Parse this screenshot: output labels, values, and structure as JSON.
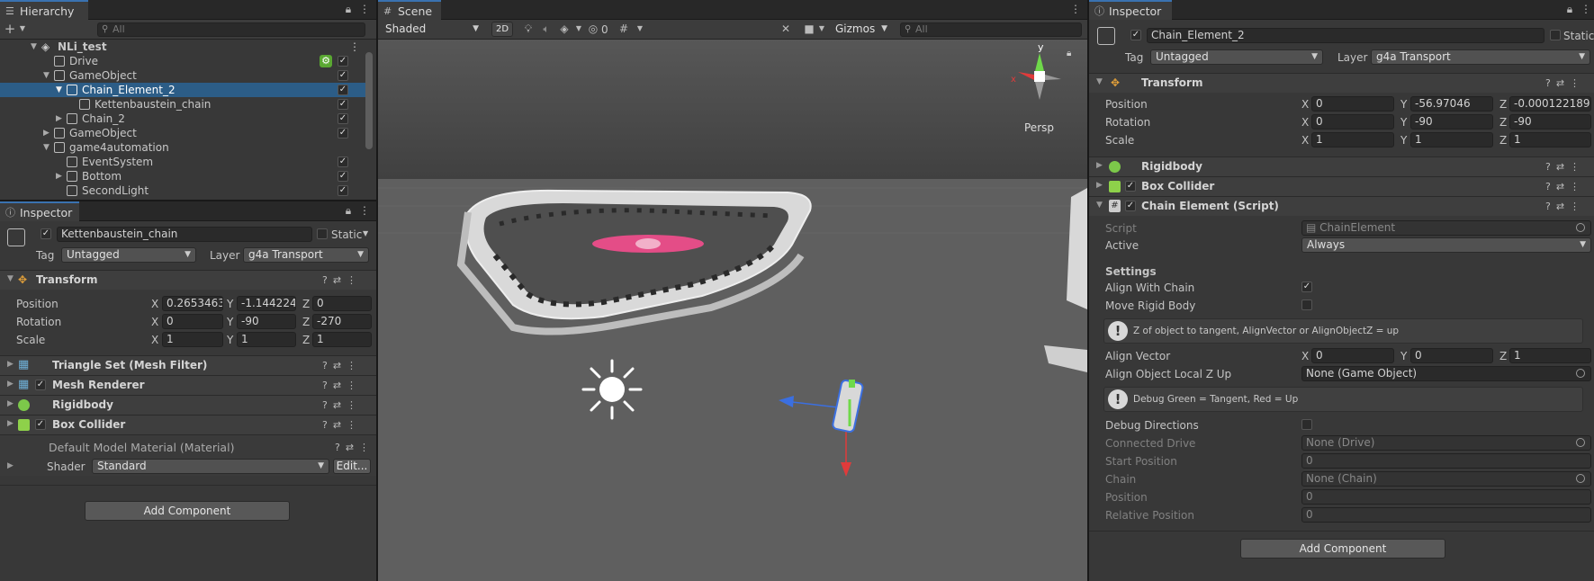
{
  "hierarchy": {
    "tab": "Hierarchy",
    "search_placeholder": "All",
    "rows": [
      {
        "label": "NLi_test"
      },
      {
        "label": "Drive"
      },
      {
        "label": "GameObject"
      },
      {
        "label": "Chain_Element_2"
      },
      {
        "label": "Kettenbaustein_chain"
      },
      {
        "label": "Chain_2"
      },
      {
        "label": "GameObject"
      },
      {
        "label": "game4automation"
      },
      {
        "label": "EventSystem"
      },
      {
        "label": "Bottom"
      },
      {
        "label": "SecondLight"
      }
    ]
  },
  "left_inspector": {
    "tab": "Inspector",
    "object_name": "Kettenbaustein_chain",
    "static_label": "Static",
    "tag_label": "Tag",
    "tag_value": "Untagged",
    "layer_label": "Layer",
    "layer_value": "g4a Transport",
    "transform": {
      "title": "Transform",
      "position_label": "Position",
      "rotation_label": "Rotation",
      "scale_label": "Scale",
      "position": {
        "x": "0.2653463",
        "y": "-1.144224",
        "z": "0"
      },
      "rotation": {
        "x": "0",
        "y": "-90",
        "z": "-270"
      },
      "scale": {
        "x": "1",
        "y": "1",
        "z": "1"
      }
    },
    "components": [
      "Triangle Set (Mesh Filter)",
      "Mesh Renderer",
      "Rigidbody",
      "Box Collider"
    ],
    "material": "Default Model Material (Material)",
    "shader_label": "Shader",
    "shader_value": "Standard",
    "edit_label": "Edit...",
    "add_component": "Add Component"
  },
  "scene": {
    "tab": "Scene",
    "shading": "Shaded",
    "mode_2d": "2D",
    "hidden_count": "0",
    "gizmos": "Gizmos",
    "search_placeholder": "All",
    "persp": "Persp",
    "gizmo_y": "y",
    "gizmo_x": "x"
  },
  "right_inspector": {
    "tab": "Inspector",
    "object_name": "Chain_Element_2",
    "static_label": "Static",
    "tag_label": "Tag",
    "tag_value": "Untagged",
    "layer_label": "Layer",
    "layer_value": "g4a Transport",
    "transform": {
      "title": "Transform",
      "position_label": "Position",
      "rotation_label": "Rotation",
      "scale_label": "Scale",
      "position": {
        "x": "0",
        "y": "-56.97046",
        "z": "-0.0001221895"
      },
      "rotation": {
        "x": "0",
        "y": "-90",
        "z": "-90"
      },
      "scale": {
        "x": "1",
        "y": "1",
        "z": "1"
      }
    },
    "components": [
      "Rigidbody",
      "Box Collider",
      "Chain Element (Script)"
    ],
    "script_label": "Script",
    "script_value": "ChainElement",
    "active_label": "Active",
    "active_value": "Always",
    "settings_header": "Settings",
    "align_with_chain": "Align With Chain",
    "move_rigid_body": "Move Rigid Body",
    "help1": "Z of object to tangent, AlignVector or AlignObjectZ = up",
    "align_vector_label": "Align Vector",
    "align_vector": {
      "x": "0",
      "y": "0",
      "z": "1"
    },
    "align_object_label": "Align Object Local Z Up",
    "align_object_value": "None (Game Object)",
    "help2": "Debug Green = Tangent, Red = Up",
    "debug_directions": "Debug Directions",
    "connected_drive_label": "Connected Drive",
    "connected_drive_value": "None (Drive)",
    "start_position_label": "Start Position",
    "start_position_value": "0",
    "chain_label": "Chain",
    "chain_value": "None (Chain)",
    "position_label": "Position",
    "position_value": "0",
    "relative_position_label": "Relative Position",
    "relative_position_value": "0",
    "add_component": "Add Component"
  },
  "axis_labels": {
    "x": "X",
    "y": "Y",
    "z": "Z"
  },
  "colors": {
    "selection": "#2c5d87",
    "accent": "#3a72b0",
    "panel": "#383838"
  }
}
